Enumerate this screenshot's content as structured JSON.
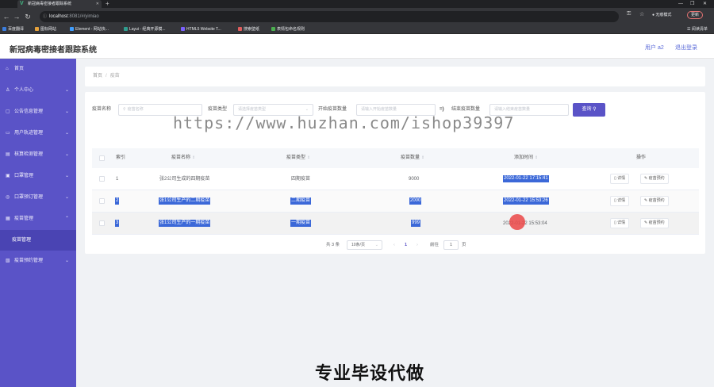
{
  "browser": {
    "tab_title": "新冠病毒密接者跟踪系统",
    "tab_icon": "V",
    "url_host": "localhost",
    "url_rest": ":8081/#/yimiao",
    "incognito_label": "无痕模式",
    "relaunch_label": "更新",
    "bookmarks": [
      {
        "label": "百度翻译",
        "color": "#3b7ddd"
      },
      {
        "label": "图标网站",
        "color": "#e6a23c"
      },
      {
        "label": "Element - 网站快...",
        "color": "#409eff"
      },
      {
        "label": "Layui - 经典开源模...",
        "color": "#2f9e8f"
      },
      {
        "label": "HTML5 Website T...",
        "color": "#7b61ff"
      },
      {
        "label": "搜索壁纸",
        "color": "#e05d5d"
      },
      {
        "label": "表情包命名规则",
        "color": "#4caf50"
      }
    ],
    "reading_list_label": "阅读清单"
  },
  "header": {
    "title": "新冠病毒密接者跟踪系统",
    "user_label": "用户 a2",
    "logout_label": "退出登录"
  },
  "sidebar": {
    "items": [
      {
        "label": "首页",
        "icon": "home-icon",
        "has_arrow": false
      },
      {
        "label": "个人中心",
        "icon": "user-icon",
        "has_arrow": true
      },
      {
        "label": "公告信息管理",
        "icon": "notice-icon",
        "has_arrow": true
      },
      {
        "label": "用户轨迹管理",
        "icon": "track-icon",
        "has_arrow": true
      },
      {
        "label": "核算检测管理",
        "icon": "test-icon",
        "has_arrow": true
      },
      {
        "label": "口罩管理",
        "icon": "mask-icon",
        "has_arrow": true
      },
      {
        "label": "口罩预订管理",
        "icon": "order-icon",
        "has_arrow": true
      },
      {
        "label": "疫苗管理",
        "icon": "vaccine-icon",
        "has_arrow": true,
        "expanded": true
      },
      {
        "label": "疫苗预约管理",
        "icon": "appointment-icon",
        "has_arrow": true
      }
    ],
    "submenu_active": "疫苗管理"
  },
  "breadcrumb": {
    "home": "首页",
    "separator": "/",
    "current": "疫苗"
  },
  "search": {
    "name_label": "疫苗名称",
    "name_placeholder": "疫苗名称",
    "type_label": "疫苗类型",
    "type_placeholder": "请选择疫苗类型",
    "start_label": "开始疫苗数量",
    "start_placeholder": "请输入开始疫苗数量",
    "range_glyph": "=}",
    "end_label": "结束疫苗数量",
    "end_placeholder": "请输入结束疫苗数量",
    "search_button": "查询"
  },
  "watermark": "https://www.huzhan.com/ishop39397",
  "table": {
    "columns": [
      "索引",
      "疫苗名称",
      "疫苗类型",
      "疫苗数量",
      "添加时间",
      "操作"
    ],
    "rows": [
      {
        "index": "1",
        "name": "张2公司生成的四期疫苗",
        "type": "四期疫苗",
        "count": "9000",
        "time": "2022-01-22 17:15:41",
        "selected": false
      },
      {
        "index": "2",
        "name": "张1公司生产的二期疫苗",
        "type": "二期疫苗",
        "count": "2000",
        "time": "2022-01-22 15:53:26",
        "selected": true
      },
      {
        "index": "3",
        "name": "张1公司生产的一期疫苗",
        "type": "一期疫苗",
        "count": "999",
        "time": "2022-01-22 15:53:04",
        "selected": true
      }
    ],
    "detail_label": "详情",
    "appointment_label": "疫苗预约"
  },
  "pagination": {
    "total": "共 3 条",
    "page_size": "10条/页",
    "prev": "‹",
    "current_page": "1",
    "next": "›",
    "goto_label": "前往",
    "goto_value": "1",
    "page_suffix": "页"
  },
  "footer_text": "专业毕设代做"
}
